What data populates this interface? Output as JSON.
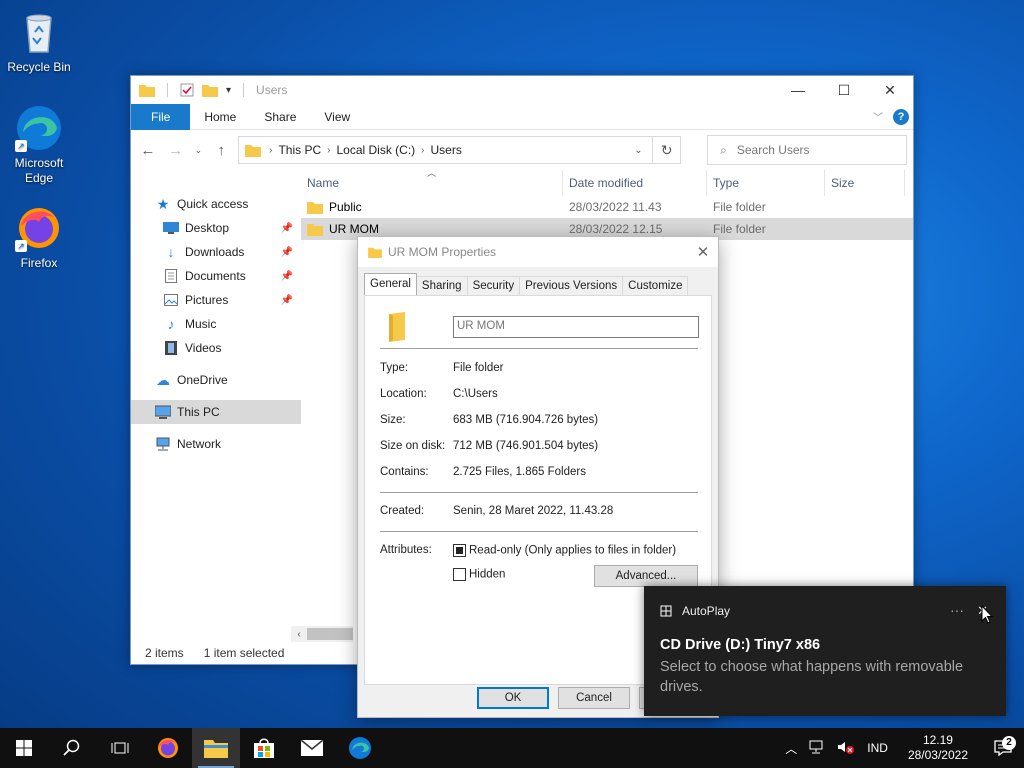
{
  "desktop": {
    "icons": [
      {
        "label": "Recycle Bin",
        "icon": "recycle-bin-icon"
      },
      {
        "label": "Microsoft Edge",
        "icon": "edge-icon"
      },
      {
        "label": "Firefox",
        "icon": "firefox-icon"
      }
    ]
  },
  "explorer": {
    "title": "Users",
    "ribbon_tabs": [
      "File",
      "Home",
      "Share",
      "View"
    ],
    "breadcrumb": [
      "This PC",
      "Local Disk (C:)",
      "Users"
    ],
    "search_placeholder": "Search Users",
    "sidebar": {
      "quick_access": "Quick access",
      "items": [
        "Desktop",
        "Downloads",
        "Documents",
        "Pictures",
        "Music",
        "Videos"
      ],
      "onedrive": "OneDrive",
      "this_pc": "This PC",
      "network": "Network"
    },
    "columns": [
      "Name",
      "Date modified",
      "Type",
      "Size"
    ],
    "rows": [
      {
        "name": "Public",
        "date": "28/03/2022 11.43",
        "type": "File folder"
      },
      {
        "name": "UR MOM",
        "date": "28/03/2022 12.15",
        "type": "File folder"
      }
    ],
    "status": {
      "count": "2 items",
      "selected": "1 item selected"
    }
  },
  "properties": {
    "title": "UR MOM Properties",
    "tabs": [
      "General",
      "Sharing",
      "Security",
      "Previous Versions",
      "Customize"
    ],
    "name_value": "UR MOM",
    "fields": {
      "type_label": "Type:",
      "type": "File folder",
      "location_label": "Location:",
      "location": "C:\\Users",
      "size_label": "Size:",
      "size": "683 MB (716.904.726 bytes)",
      "size_on_disk_label": "Size on disk:",
      "size_on_disk": "712 MB (746.901.504 bytes)",
      "contains_label": "Contains:",
      "contains": "2.725 Files, 1.865 Folders",
      "created_label": "Created:",
      "created": "Senin, 28 Maret 2022, 11.43.28",
      "attributes_label": "Attributes:",
      "readonly": "Read-only (Only applies to files in folder)",
      "hidden": "Hidden"
    },
    "advanced_label": "Advanced...",
    "ok_label": "OK",
    "cancel_label": "Cancel"
  },
  "toast": {
    "app": "AutoPlay",
    "more": "···",
    "title": "CD Drive (D:) Tiny7 x86",
    "body": "Select to choose what happens with removable drives."
  },
  "taskbar": {
    "language": "IND",
    "time": "12.19",
    "date": "28/03/2022",
    "notifications": "2"
  },
  "colors": {
    "accent": "#0078d7",
    "folder": "#f6c94a",
    "taskbar": "#101010"
  }
}
